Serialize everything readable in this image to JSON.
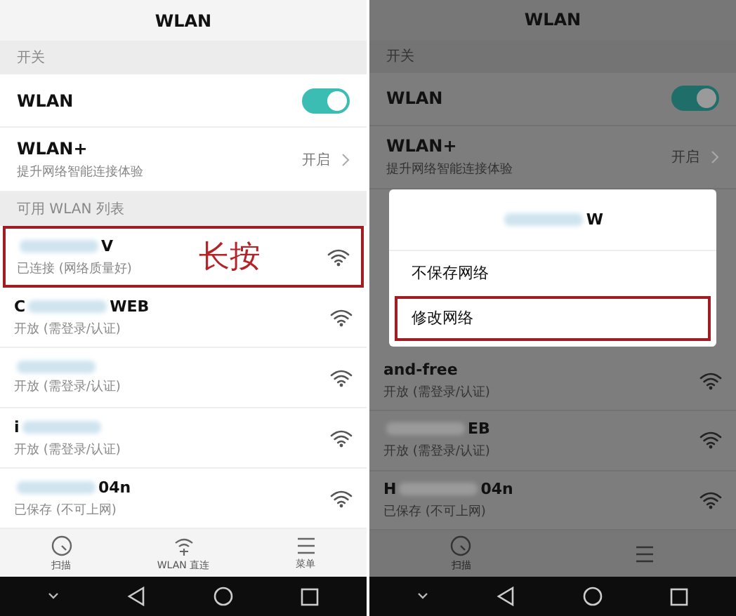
{
  "panels": [
    {
      "dimmed": false,
      "title": "WLAN",
      "switch_section": "开关",
      "wlan": {
        "label": "WLAN",
        "on": true
      },
      "wlan_plus": {
        "label": "WLAN+",
        "subtitle": "提升网络智能连接体验",
        "value": "开启"
      },
      "list_section": "可用 WLAN 列表",
      "annotation": "长按",
      "networks": [
        {
          "name_end": "V",
          "blurred": true,
          "status": "已连接 (网络质量好)",
          "highlighted": true
        },
        {
          "name_start": "C",
          "name_end": "WEB",
          "blurred": true,
          "status": "开放 (需登录/认证)",
          "highlighted": false
        },
        {
          "blurred": true,
          "status": "开放 (需登录/认证)",
          "highlighted": false
        },
        {
          "name_start": "i",
          "blurred": true,
          "status": "开放 (需登录/认证)",
          "highlighted": false
        },
        {
          "name_end": "04n",
          "blurred": true,
          "status": "已保存 (不可上网)",
          "highlighted": false
        }
      ],
      "bottom_nav": [
        {
          "kind": "scan",
          "label": "扫描"
        },
        {
          "kind": "direct",
          "label": "WLAN 直连"
        },
        {
          "kind": "menu",
          "label": "菜单"
        }
      ]
    },
    {
      "dimmed": true,
      "title": "WLAN",
      "switch_section": "开关",
      "wlan": {
        "label": "WLAN",
        "on": true
      },
      "wlan_plus": {
        "label": "WLAN+",
        "subtitle": "提升网络智能连接体验",
        "value": "开启"
      },
      "dialog": {
        "title_end": "W",
        "blurred": true,
        "options": [
          {
            "label": "不保存网络",
            "highlighted": false
          },
          {
            "label": "修改网络",
            "highlighted": true
          }
        ]
      },
      "networks": [
        {
          "name_end": "and-free",
          "blurred": false,
          "status": "开放 (需登录/认证)",
          "highlighted": false
        },
        {
          "name_end": "EB",
          "blurred": true,
          "status": "开放 (需登录/认证)",
          "highlighted": false
        },
        {
          "name_start": "H",
          "name_end": "04n",
          "blurred": true,
          "status": "已保存 (不可上网)",
          "highlighted": false
        }
      ],
      "bottom_nav": [
        {
          "kind": "scan",
          "label": "扫描"
        },
        {
          "kind": "menu"
        }
      ]
    }
  ]
}
